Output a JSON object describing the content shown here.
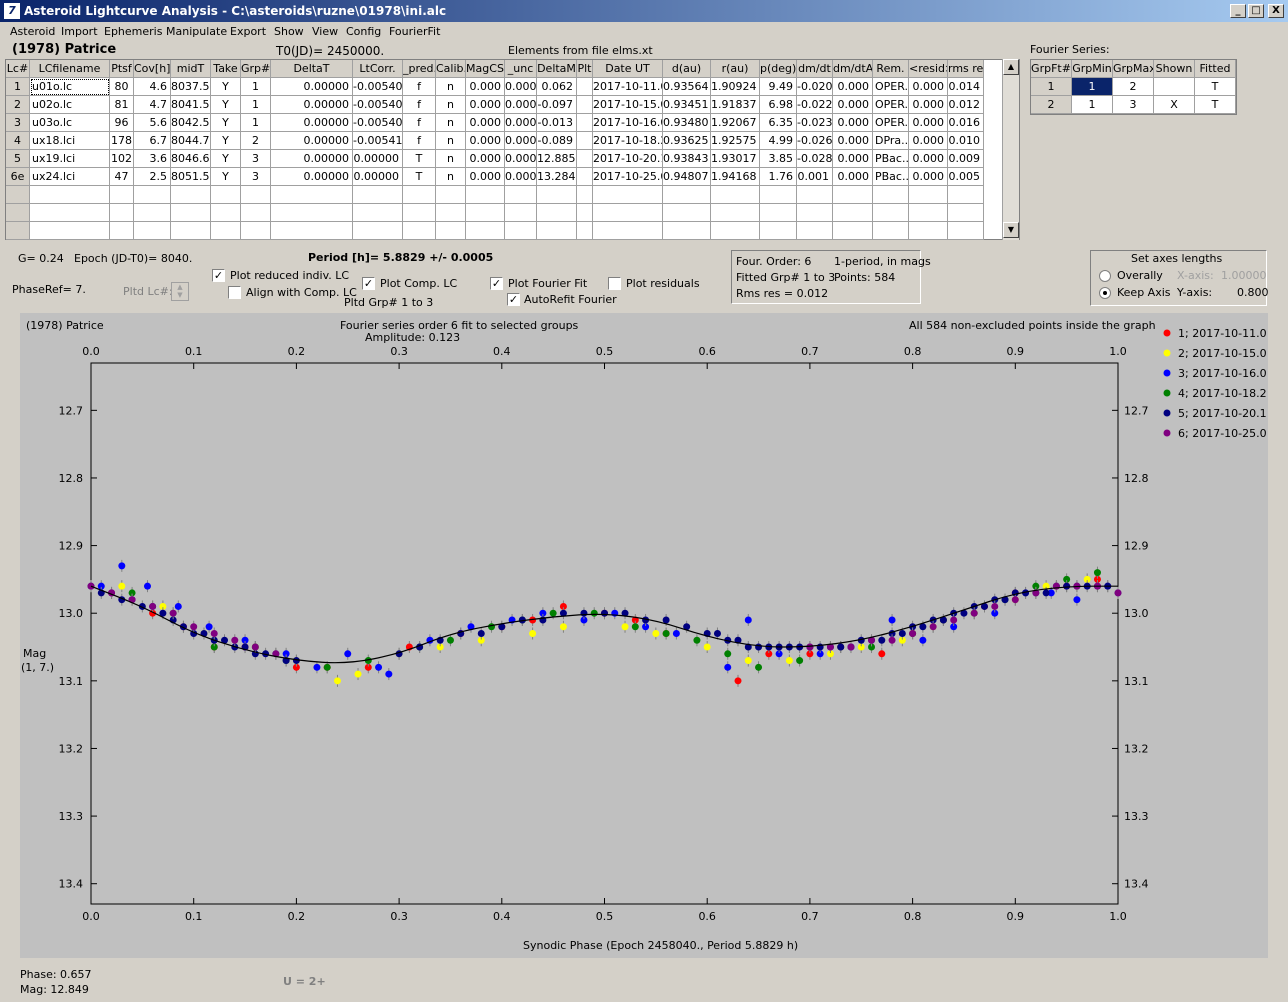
{
  "window": {
    "title": "Asteroid Lightcurve Analysis - C:\\asteroids\\ruzne\\01978\\ini.alc",
    "icon": "7",
    "minimize": "_",
    "maximize": "□",
    "close": "X"
  },
  "menu": [
    "Asteroid",
    "Import",
    "Ephemeris",
    "Manipulate",
    "Export",
    "Show",
    "View",
    "Config",
    "FourierFit"
  ],
  "header": {
    "asteroid": "(1978) Patrice",
    "t0": "T0(JD)= 2450000.",
    "elements": "Elements from file elms.xt",
    "fourier_series_label": "Fourier Series:"
  },
  "lc_table": {
    "columns": [
      "Lc#",
      "LCfilename",
      "Ptsf",
      "Cov[h]",
      "midT",
      "Take",
      "Grp#",
      "DeltaT",
      "LtCorr.",
      "_pred.",
      "Calib.",
      "MagCS",
      "_unc",
      "DeltaM",
      "Plt",
      "Date UT",
      "d(au)",
      "r(au)",
      "p(deg)",
      "dm/dt",
      "dm/dtA",
      "Rem.",
      "<resid>",
      "rms res"
    ],
    "rows": [
      [
        "1",
        "u01o.lc",
        "80",
        "4.6",
        "8037.5",
        "Y",
        "1",
        "0.00000",
        "-0.00540",
        "f",
        "n",
        "0.000",
        "0.000",
        "0.062",
        "",
        "2017-10-11.0",
        "0.93564",
        "1.90924",
        "9.49",
        "-0.020",
        "0.000",
        "OPER.",
        "0.000",
        "0.014"
      ],
      [
        "2",
        "u02o.lc",
        "81",
        "4.7",
        "8041.5",
        "Y",
        "1",
        "0.00000",
        "-0.00540",
        "f",
        "n",
        "0.000",
        "0.000",
        "-0.097",
        "",
        "2017-10-15.0",
        "0.93451",
        "1.91837",
        "6.98",
        "-0.022",
        "0.000",
        "OPER.",
        "0.000",
        "0.012"
      ],
      [
        "3",
        "u03o.lc",
        "96",
        "5.6",
        "8042.5",
        "Y",
        "1",
        "0.00000",
        "-0.00540",
        "f",
        "n",
        "0.000",
        "0.000",
        "-0.013",
        "",
        "2017-10-16.0",
        "0.93480",
        "1.92067",
        "6.35",
        "-0.023",
        "0.000",
        "OPER.",
        "0.000",
        "0.016"
      ],
      [
        "4",
        "ux18.lci",
        "178",
        "6.7",
        "8044.7",
        "Y",
        "2",
        "0.00000",
        "-0.00541",
        "f",
        "n",
        "0.000",
        "0.000",
        "-0.089",
        "",
        "2017-10-18.2",
        "0.93625",
        "1.92575",
        "4.99",
        "-0.026",
        "0.000",
        "DPra..",
        "0.000",
        "0.010"
      ],
      [
        "5",
        "ux19.lci",
        "102",
        "3.6",
        "8046.6",
        "Y",
        "3",
        "0.00000",
        "0.00000",
        "T",
        "n",
        "0.000",
        "0.000",
        "12.885",
        "",
        "2017-10-20.1",
        "0.93843",
        "1.93017",
        "3.85",
        "-0.028",
        "0.000",
        "PBac..",
        "0.000",
        "0.009"
      ],
      [
        "6e",
        "ux24.lci",
        "47",
        "2.5",
        "8051.5",
        "Y",
        "3",
        "0.00000",
        "0.00000",
        "T",
        "n",
        "0.000",
        "0.000",
        "13.284",
        "",
        "2017-10-25.0",
        "0.94807",
        "1.94168",
        "1.76",
        "0.001",
        "0.000",
        "PBac..",
        "0.000",
        "0.005"
      ]
    ],
    "empty_rows": 3
  },
  "fourier_table": {
    "columns": [
      "GrpFt#",
      "GrpMin",
      "GrpMax",
      "Shown",
      "Fitted"
    ],
    "rows": [
      [
        "1",
        "1",
        "2",
        "",
        "T"
      ],
      [
        "2",
        "1",
        "3",
        "X",
        "T"
      ]
    ]
  },
  "controls": {
    "g": "G= 0.24",
    "epoch": "Epoch (JD-T0)= 8040.",
    "period": "Period [h]= 5.8829 +/- 0.0005",
    "phaseref": "PhaseRef= 7.",
    "pltd_lc": "Pltd Lc#:",
    "plot_reduced": "Plot reduced indiv. LC",
    "align_comp": "Align with Comp. LC",
    "plot_comp": "Plot Comp. LC",
    "pltd_grp": "Pltd Grp#  1   to    3",
    "plot_fourier": "Plot Fourier Fit",
    "autorefit": "AutoRefit Fourier",
    "plot_residuals": "Plot residuals",
    "checks": {
      "plot_reduced": true,
      "align_comp": false,
      "plot_comp": true,
      "plot_fourier": true,
      "autorefit": true,
      "plot_residuals": false
    }
  },
  "fit_info": {
    "order": "Four. Order:  6",
    "period_mode": "1-period, in mags",
    "fitted": "Fitted Grp# 1 to 3",
    "points": "Points: 584",
    "rms": "Rms res     = 0.012"
  },
  "axes_panel": {
    "title": "Set axes lengths",
    "overally": "Overally",
    "keep_axis": "Keep Axis",
    "x_label": "X-axis:",
    "x_value": "1.00000",
    "y_label": "Y-axis:",
    "y_value": "0.800",
    "selected": "keep_axis"
  },
  "plot": {
    "name": "(1978) Patrice",
    "title": "Fourier series order 6 fit to selected groups",
    "amplitude": "Amplitude: 0.123",
    "note": "All 584 non-excluded points inside the graph",
    "ylabel": "Mag",
    "ylabel2": "(1, 7.)",
    "xlabel": "Synodic Phase (Epoch 2458040., Period 5.8829 h)"
  },
  "status": {
    "phase": "Phase:  0.657",
    "mag": "Mag:    12.849",
    "u": "U = 2+"
  },
  "chart_data": {
    "type": "scatter",
    "xlabel": "Synodic Phase (Epoch 2458040., Period 5.8829 h)",
    "ylabel": "Mag",
    "xlim": [
      0.0,
      1.0
    ],
    "ylim": [
      13.43,
      12.63
    ],
    "y_inverted": true,
    "xticks": [
      "0.0",
      "0.1",
      "0.2",
      "0.3",
      "0.4",
      "0.5",
      "0.6",
      "0.7",
      "0.8",
      "0.9",
      "1.0"
    ],
    "yticks": [
      "12.7",
      "12.8",
      "12.9",
      "13.0",
      "13.1",
      "13.2",
      "13.3",
      "13.4"
    ],
    "fourier_curve": {
      "x": [
        0.0,
        0.05,
        0.1,
        0.15,
        0.2,
        0.25,
        0.3,
        0.35,
        0.4,
        0.45,
        0.5,
        0.55,
        0.6,
        0.65,
        0.7,
        0.75,
        0.8,
        0.85,
        0.9,
        0.95,
        1.0
      ],
      "y": [
        12.96,
        12.99,
        13.03,
        13.055,
        13.07,
        13.075,
        13.06,
        13.03,
        13.015,
        13.005,
        13.0,
        13.01,
        13.035,
        13.05,
        13.05,
        13.04,
        13.02,
        12.995,
        12.97,
        12.96,
        12.96
      ]
    },
    "series": [
      {
        "name": "1; 2017-10-11.0",
        "color": "#ff0000",
        "x": [
          0.02,
          0.06,
          0.09,
          0.12,
          0.15,
          0.2,
          0.23,
          0.27,
          0.31,
          0.36,
          0.4,
          0.43,
          0.46,
          0.5,
          0.53,
          0.56,
          0.63,
          0.66,
          0.7,
          0.73,
          0.77,
          0.8,
          0.83,
          0.87,
          0.9,
          0.95,
          0.98
        ],
        "y": [
          12.97,
          13.0,
          13.02,
          13.05,
          13.05,
          13.08,
          13.08,
          13.08,
          13.05,
          13.03,
          13.02,
          13.01,
          12.99,
          13.0,
          13.01,
          13.03,
          13.1,
          13.06,
          13.06,
          13.05,
          13.06,
          13.03,
          13.01,
          12.99,
          12.97,
          12.96,
          12.95
        ]
      },
      {
        "name": "2; 2017-10-15.0",
        "color": "#ffff00",
        "x": [
          0.03,
          0.07,
          0.11,
          0.16,
          0.2,
          0.24,
          0.26,
          0.3,
          0.34,
          0.38,
          0.43,
          0.46,
          0.52,
          0.55,
          0.6,
          0.64,
          0.68,
          0.72,
          0.75,
          0.79,
          0.82,
          0.86,
          0.9,
          0.93,
          0.97
        ],
        "y": [
          12.96,
          12.99,
          13.03,
          13.05,
          13.07,
          13.1,
          13.09,
          13.06,
          13.05,
          13.04,
          13.03,
          13.02,
          13.02,
          13.03,
          13.05,
          13.07,
          13.07,
          13.06,
          13.05,
          13.04,
          13.02,
          13.0,
          12.98,
          12.96,
          12.95
        ]
      },
      {
        "name": "3; 2017-10-16.0",
        "color": "#0000ff",
        "x": [
          0.01,
          0.03,
          0.055,
          0.085,
          0.115,
          0.15,
          0.19,
          0.22,
          0.25,
          0.28,
          0.29,
          0.33,
          0.37,
          0.41,
          0.44,
          0.48,
          0.51,
          0.54,
          0.57,
          0.62,
          0.64,
          0.67,
          0.71,
          0.74,
          0.78,
          0.81,
          0.84,
          0.88,
          0.91,
          0.935,
          0.96,
          0.99
        ],
        "y": [
          12.96,
          12.93,
          12.96,
          12.99,
          13.02,
          13.04,
          13.06,
          13.08,
          13.06,
          13.08,
          13.09,
          13.04,
          13.02,
          13.01,
          13.0,
          13.01,
          13.0,
          13.02,
          13.03,
          13.08,
          13.01,
          13.06,
          13.06,
          13.05,
          13.01,
          13.04,
          13.02,
          13.0,
          12.97,
          12.97,
          12.98,
          12.96
        ]
      },
      {
        "name": "4; 2017-10-18.2",
        "color": "#008000",
        "x": [
          0.04,
          0.08,
          0.12,
          0.16,
          0.19,
          0.23,
          0.27,
          0.32,
          0.35,
          0.39,
          0.42,
          0.45,
          0.49,
          0.53,
          0.56,
          0.59,
          0.62,
          0.65,
          0.69,
          0.73,
          0.76,
          0.8,
          0.83,
          0.86,
          0.89,
          0.92,
          0.95,
          0.98
        ],
        "y": [
          12.97,
          13.0,
          13.05,
          13.05,
          13.07,
          13.08,
          13.07,
          13.05,
          13.04,
          13.02,
          13.01,
          13.0,
          13.0,
          13.02,
          13.03,
          13.04,
          13.06,
          13.08,
          13.07,
          13.05,
          13.05,
          13.03,
          13.01,
          13.0,
          12.98,
          12.96,
          12.95,
          12.94
        ]
      },
      {
        "name": "5; 2017-10-20.1",
        "color": "#000080",
        "x": [
          0.0,
          0.01,
          0.02,
          0.03,
          0.04,
          0.05,
          0.06,
          0.07,
          0.08,
          0.09,
          0.1,
          0.11,
          0.12,
          0.13,
          0.14,
          0.15,
          0.16,
          0.17,
          0.18,
          0.19,
          0.2,
          0.3,
          0.32,
          0.34,
          0.36,
          0.38,
          0.4,
          0.42,
          0.44,
          0.46,
          0.48,
          0.5,
          0.52,
          0.54,
          0.56,
          0.58,
          0.6,
          0.61,
          0.62,
          0.63,
          0.64,
          0.65,
          0.66,
          0.67,
          0.68,
          0.69,
          0.7,
          0.71,
          0.72,
          0.73,
          0.74,
          0.75,
          0.76,
          0.77,
          0.78,
          0.79,
          0.8,
          0.81,
          0.82,
          0.83,
          0.84,
          0.85,
          0.86,
          0.87,
          0.88,
          0.89,
          0.9,
          0.91,
          0.92,
          0.93,
          0.94,
          0.95,
          0.96,
          0.97,
          0.98,
          0.99,
          1.0
        ],
        "y": [
          12.96,
          12.97,
          12.97,
          12.98,
          12.98,
          12.99,
          12.99,
          13.0,
          13.01,
          13.02,
          13.03,
          13.03,
          13.04,
          13.04,
          13.05,
          13.05,
          13.06,
          13.06,
          13.06,
          13.07,
          13.07,
          13.06,
          13.05,
          13.04,
          13.03,
          13.03,
          13.02,
          13.01,
          13.01,
          13.0,
          13.0,
          13.0,
          13.0,
          13.01,
          13.01,
          13.02,
          13.03,
          13.03,
          13.04,
          13.04,
          13.05,
          13.05,
          13.05,
          13.05,
          13.05,
          13.05,
          13.05,
          13.05,
          13.05,
          13.05,
          13.05,
          13.04,
          13.04,
          13.04,
          13.03,
          13.03,
          13.02,
          13.02,
          13.01,
          13.01,
          13.0,
          13.0,
          12.99,
          12.99,
          12.98,
          12.98,
          12.97,
          12.97,
          12.97,
          12.97,
          12.96,
          12.96,
          12.96,
          12.96,
          12.96,
          12.96,
          12.97
        ]
      },
      {
        "name": "6; 2017-10-25.0",
        "color": "#800080",
        "x": [
          0.0,
          0.02,
          0.04,
          0.06,
          0.08,
          0.1,
          0.12,
          0.14,
          0.16,
          0.18,
          0.7,
          0.72,
          0.74,
          0.76,
          0.78,
          0.8,
          0.82,
          0.84,
          0.86,
          0.88,
          0.9,
          0.92,
          0.94,
          0.96,
          0.98,
          1.0
        ],
        "y": [
          12.96,
          12.97,
          12.98,
          12.99,
          13.0,
          13.02,
          13.03,
          13.04,
          13.05,
          13.06,
          13.05,
          13.05,
          13.05,
          13.04,
          13.04,
          13.03,
          13.02,
          13.01,
          13.0,
          12.99,
          12.98,
          12.97,
          12.96,
          12.96,
          12.96,
          12.97
        ]
      }
    ]
  }
}
